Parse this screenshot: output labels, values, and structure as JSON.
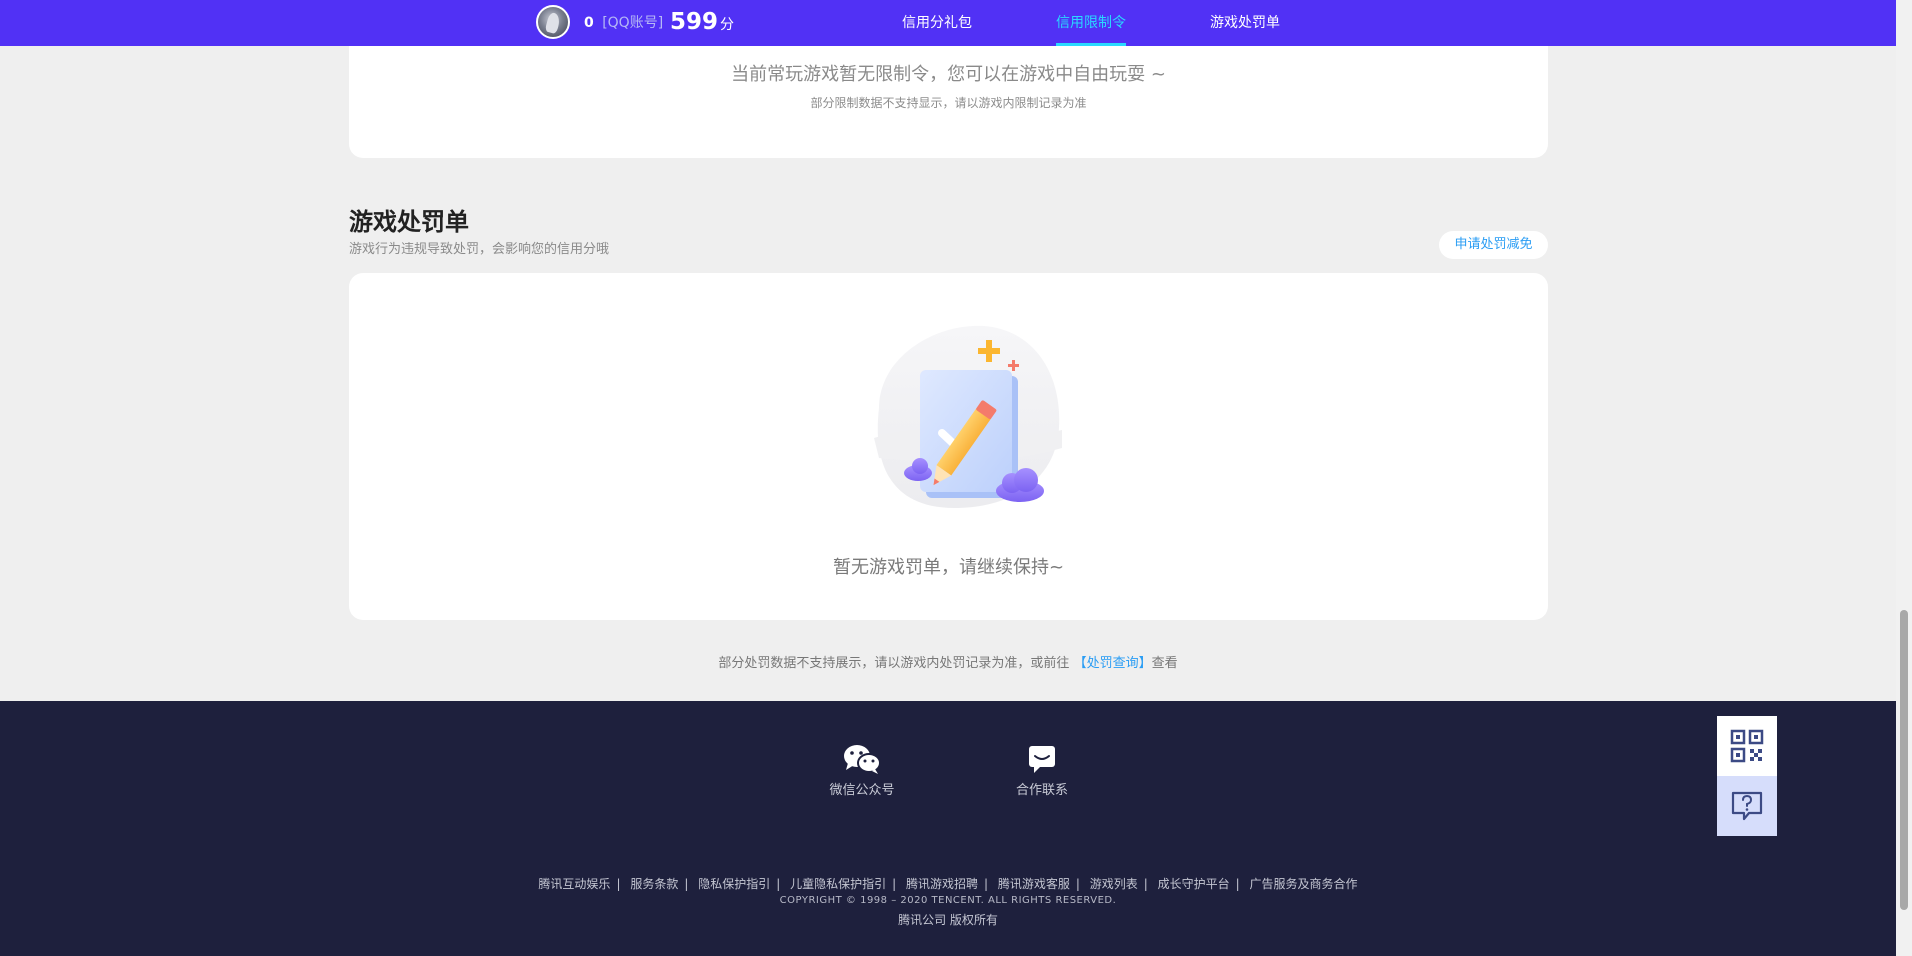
{
  "header": {
    "account_number": "0",
    "account_type": "[QQ账号]",
    "score_value": "599",
    "score_unit": "分",
    "nav": [
      {
        "label": "信用分礼包",
        "active": false
      },
      {
        "label": "信用限制令",
        "active": true
      },
      {
        "label": "游戏处罚单",
        "active": false
      }
    ],
    "colors": {
      "background": "#5131f5",
      "active": "#29d9ff"
    }
  },
  "restriction_card": {
    "message": "当前常玩游戏暂无限制令，您可以在游戏中自由玩耍 ~",
    "sub_message": "部分限制数据不支持显示，请以游戏内限制记录为准"
  },
  "penalty_section": {
    "title": "游戏处罚单",
    "description": "游戏行为违规导致处罚，会影响您的信用分哦",
    "appeal_button": "申请处罚减免",
    "empty_text": "暂无游戏罚单，请继续保持~",
    "illustration_icon": "empty-folder-check-pencil-illustration"
  },
  "note": {
    "text_before": "部分处罚数据不支持展示，请以游戏内处罚记录为准，或前往",
    "link": "【处罚查询】",
    "text_after": "查看"
  },
  "footer": {
    "icons": [
      {
        "label": "微信公众号",
        "icon": "wechat-icon"
      },
      {
        "label": "合作联系",
        "icon": "message-icon"
      }
    ],
    "links": [
      "腾讯互动娱乐",
      "服务条款",
      "隐私保护指引",
      "儿童隐私保护指引",
      "腾讯游戏招聘",
      "腾讯游戏客服",
      "游戏列表",
      "成长守护平台",
      "广告服务及商务合作"
    ],
    "copyright": "COPYRIGHT © 1998 – 2020 TENCENT. ALL RIGHTS RESERVED.",
    "company": "腾讯公司 版权所有"
  },
  "floating": {
    "qr_icon": "qr-code-icon",
    "help_icon": "help-chat-icon"
  }
}
